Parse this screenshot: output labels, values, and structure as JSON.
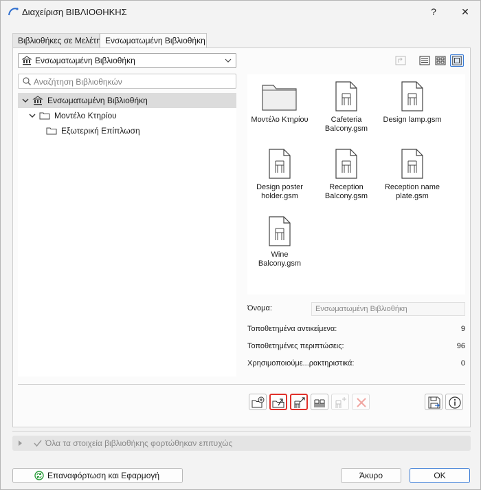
{
  "window": {
    "title": "Διαχείριση ΒΙΒΛΙΟΘΗΚΗΣ",
    "help_label": "?",
    "close_label": "✕"
  },
  "tabs": [
    {
      "label": "Βιβλιοθήκες σε Μελέτη"
    },
    {
      "label": "Ενσωματωμένη Βιβλιοθήκη"
    }
  ],
  "library_dropdown": {
    "value": "Ενσωματωμένη Βιβλιοθήκη"
  },
  "search": {
    "placeholder": "Αναζήτηση Βιβλιοθηκών"
  },
  "tree": [
    {
      "label": "Ενσωματωμένη Βιβλιοθήκη",
      "selected": true,
      "icon": "library-icon"
    },
    {
      "label": "Μοντέλο Κτηρίου",
      "icon": "folder-icon"
    },
    {
      "label": "Εξωτερική Επίπλωση",
      "icon": "folder-icon"
    }
  ],
  "items": [
    {
      "label": "Μοντέλο Κτηρίου",
      "icon": "folder-icon"
    },
    {
      "label": "Cafeteria Balcony.gsm",
      "icon": "gsm-file-icon"
    },
    {
      "label": "Design lamp.gsm",
      "icon": "gsm-file-icon"
    },
    {
      "label": "Design poster holder.gsm",
      "icon": "gsm-file-icon"
    },
    {
      "label": "Reception Balcony.gsm",
      "icon": "gsm-file-icon"
    },
    {
      "label": "Reception name plate.gsm",
      "icon": "gsm-file-icon"
    },
    {
      "label": "Wine Balcony.gsm",
      "icon": "gsm-file-icon"
    }
  ],
  "info": {
    "name_label": "Όνομα:",
    "name_value": "Ενσωματωμένη Βιβλιοθήκη",
    "placed_objects_label": "Τοποθετημένα αντικείμενα:",
    "placed_objects_value": "9",
    "placed_instances_label": "Τοποθετημένες περιπτώσεις:",
    "placed_instances_value": "96",
    "used_attributes_label": "Χρησιμοποιούμε...ρακτηριστικά:",
    "used_attributes_value": "0"
  },
  "status": {
    "text": "Όλα τα στοιχεία βιβλιοθήκης φορτώθηκαν επιτυχώς"
  },
  "buttons": {
    "reload": "Επαναφόρτωση και Εφαρμογή",
    "cancel": "Άκυρο",
    "ok": "OK"
  },
  "colors": {
    "accent": "#3a7bd5",
    "highlight": "#e0302a",
    "selected_row": "#dcdcdc"
  }
}
